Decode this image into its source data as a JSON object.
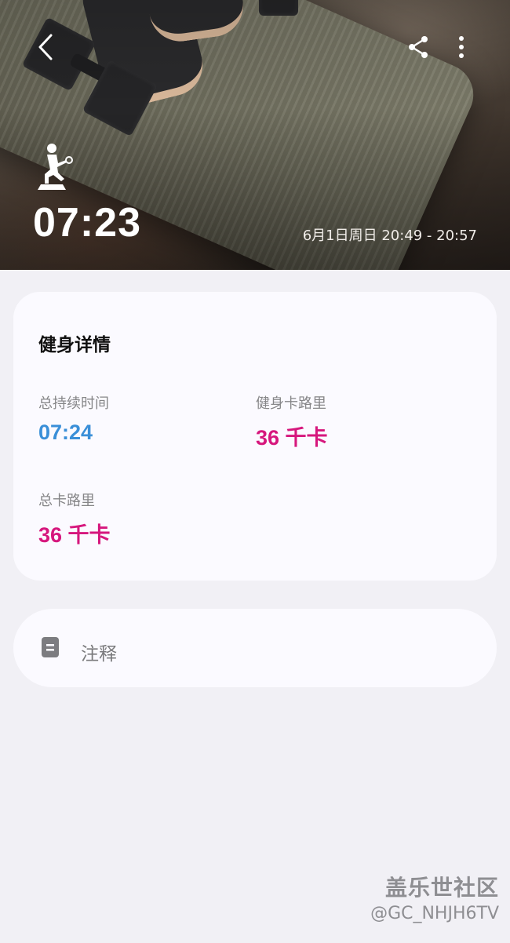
{
  "header": {
    "duration": "07:23",
    "datetime": "6月1日周日 20:49 - 20:57",
    "activity_icon": "workout-figure-icon",
    "back_icon": "chevron-left-icon",
    "share_icon": "share-icon",
    "more_icon": "more-vertical-icon"
  },
  "details": {
    "title": "健身详情",
    "metrics": [
      {
        "label": "总持续时间",
        "value": "07:24",
        "color": "#3a8fd8"
      },
      {
        "label": "健身卡路里",
        "value": "36 千卡",
        "color": "#d6177d"
      },
      {
        "label": "总卡路里",
        "value": "36 千卡",
        "color": "#d6177d"
      }
    ]
  },
  "notes": {
    "label": "注释",
    "icon": "note-icon"
  },
  "watermark": {
    "title": "盖乐世社区",
    "handle": "@GC_NHJH6TV"
  }
}
